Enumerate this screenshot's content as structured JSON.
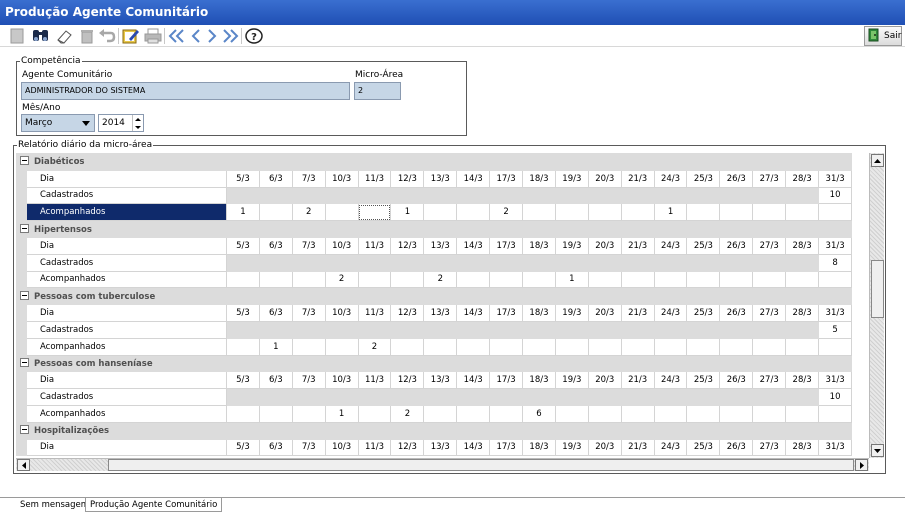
{
  "window": {
    "title": "Produção Agente Comunitário"
  },
  "toolbar": {
    "icons": [
      "new-icon",
      "search-icon",
      "eraser-icon",
      "trash-icon",
      "undo-icon",
      "edit-icon",
      "print-icon",
      "first-icon",
      "previous-icon",
      "next-icon",
      "last-icon",
      "help-icon"
    ],
    "exit_label": "Sair"
  },
  "competencia": {
    "legend": "Competência",
    "agent_label": "Agente Comunitário",
    "agent_value": "ADMINISTRADOR DO SISTEMA",
    "micro_label": "Micro-Área",
    "micro_value": "2",
    "mes_ano_label": "Mês/Ano",
    "month_value": "Março",
    "year_value": "2014"
  },
  "report": {
    "legend": "Relatório diário da micro-área",
    "days": [
      "5/3",
      "6/3",
      "7/3",
      "10/3",
      "11/3",
      "12/3",
      "13/3",
      "14/3",
      "17/3",
      "18/3",
      "19/3",
      "20/3",
      "21/3",
      "24/3",
      "25/3",
      "26/3",
      "27/3",
      "28/3",
      "31/3"
    ],
    "groups": [
      {
        "name": "Diabéticos",
        "rows": [
          {
            "label": "Dia",
            "type": "days"
          },
          {
            "label": "Cadastrados",
            "type": "total",
            "total": "10"
          },
          {
            "label": "Acompanhados",
            "type": "values",
            "selected": true,
            "values": [
              "1",
              "",
              "2",
              "",
              "",
              "1",
              "",
              "",
              "2",
              "",
              "",
              "",
              "",
              "1",
              "",
              "",
              "",
              "",
              ""
            ]
          }
        ]
      },
      {
        "name": "Hipertensos",
        "rows": [
          {
            "label": "Dia",
            "type": "days"
          },
          {
            "label": "Cadastrados",
            "type": "total",
            "total": "8"
          },
          {
            "label": "Acompanhados",
            "type": "values",
            "values": [
              "",
              "",
              "",
              "2",
              "",
              "",
              "2",
              "",
              "",
              "",
              "1",
              "",
              "",
              "",
              "",
              "",
              "",
              "",
              ""
            ]
          }
        ]
      },
      {
        "name": "Pessoas com tuberculose",
        "rows": [
          {
            "label": "Dia",
            "type": "days"
          },
          {
            "label": "Cadastrados",
            "type": "total",
            "total": "5"
          },
          {
            "label": "Acompanhados",
            "type": "values",
            "values": [
              "",
              "1",
              "",
              "",
              "2",
              "",
              "",
              "",
              "",
              "",
              "",
              "",
              "",
              "",
              "",
              "",
              "",
              "",
              ""
            ]
          }
        ]
      },
      {
        "name": "Pessoas com hanseníase",
        "rows": [
          {
            "label": "Dia",
            "type": "days"
          },
          {
            "label": "Cadastrados",
            "type": "total",
            "total": "10"
          },
          {
            "label": "Acompanhados",
            "type": "values",
            "values": [
              "",
              "",
              "",
              "1",
              "",
              "2",
              "",
              "",
              "",
              "6",
              "",
              "",
              "",
              "",
              "",
              "",
              "",
              "",
              ""
            ]
          }
        ]
      },
      {
        "name": "Hospitalizações",
        "rows": [
          {
            "label": "Dia",
            "type": "days"
          }
        ]
      }
    ]
  },
  "status": {
    "tab1": "Sem mensagem",
    "tab2": "Produção Agente Comunitário"
  }
}
